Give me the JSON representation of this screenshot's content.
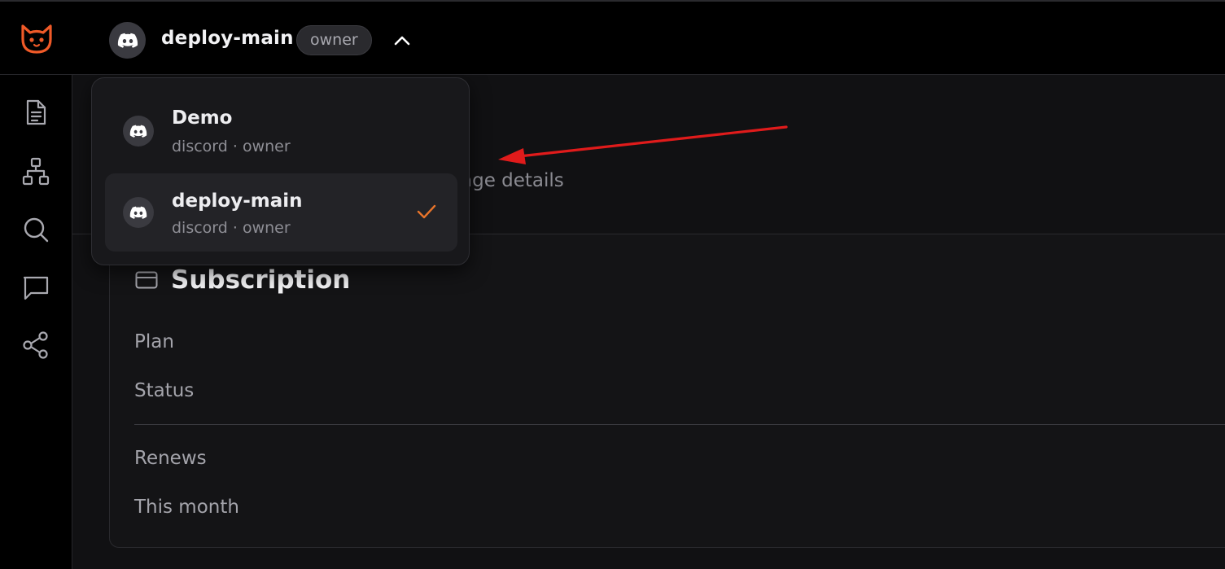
{
  "header": {
    "server_name": "deploy-main",
    "role_badge": "owner"
  },
  "sidebar": {
    "items": [
      {
        "icon": "document-icon"
      },
      {
        "icon": "sitemap-icon"
      },
      {
        "icon": "search-icon"
      },
      {
        "icon": "chat-icon"
      },
      {
        "icon": "share-icon"
      }
    ]
  },
  "page": {
    "subtitle_partial": "age details"
  },
  "subscription": {
    "title": "Subscription",
    "rows": [
      "Plan",
      "Status",
      "Renews",
      "This month"
    ]
  },
  "dropdown": {
    "options": [
      {
        "name": "Demo",
        "detail": "discord · owner",
        "selected": false
      },
      {
        "name": "deploy-main",
        "detail": "discord · owner",
        "selected": true
      }
    ]
  },
  "colors": {
    "accent": "#e8742a",
    "logo": "#f05a28",
    "annotation_arrow": "#e01b1b"
  }
}
